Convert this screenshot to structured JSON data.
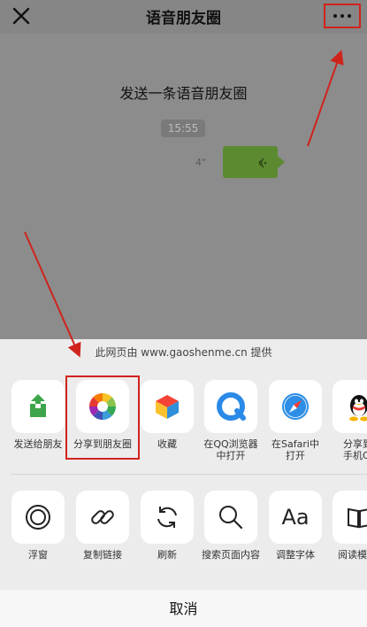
{
  "navbar": {
    "title": "语音朋友圈"
  },
  "post": {
    "title": "发送一条语音朋友圈",
    "time": "15:55",
    "voice_duration": "4\""
  },
  "sheet": {
    "source": "此网页由 www.gaoshenme.cn 提供",
    "row1": [
      {
        "label": "发送给朋友",
        "icon": "share-up-icon"
      },
      {
        "label": "分享到朋友圈",
        "icon": "moments-icon"
      },
      {
        "label": "收藏",
        "icon": "favorite-cube-icon"
      },
      {
        "label": "在QQ浏览器",
        "label2": "中打开",
        "icon": "qq-browser-icon"
      },
      {
        "label": "在Safari中",
        "label2": "打开",
        "icon": "safari-icon"
      },
      {
        "label": "分享到",
        "label2": "手机QQ",
        "icon": "qq-penguin-icon"
      }
    ],
    "row2": [
      {
        "label": "浮窗",
        "icon": "float-window-icon"
      },
      {
        "label": "复制链接",
        "icon": "link-icon"
      },
      {
        "label": "刷新",
        "icon": "refresh-icon"
      },
      {
        "label": "搜索页面内容",
        "icon": "search-icon"
      },
      {
        "label": "调整字体",
        "icon": "font-icon",
        "glyph": "Aa"
      },
      {
        "label": "阅读模式",
        "icon": "book-icon"
      }
    ],
    "cancel": "取消"
  },
  "colors": {
    "highlight": "#d0231c",
    "bubble": "#5c8a31",
    "sheet": "#ececec"
  }
}
